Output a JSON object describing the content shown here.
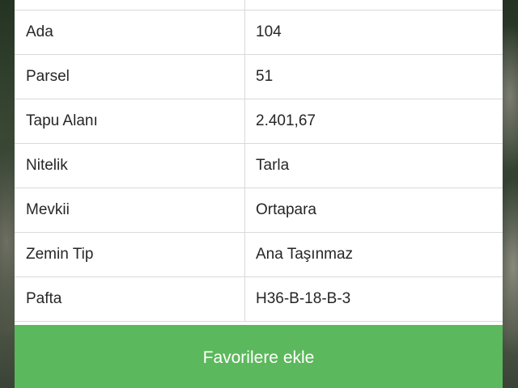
{
  "parcel_info": {
    "rows": [
      {
        "label": "",
        "value": ""
      },
      {
        "label": "Ada",
        "value": "104"
      },
      {
        "label": "Parsel",
        "value": "51"
      },
      {
        "label": "Tapu Alanı",
        "value": "2.401,67"
      },
      {
        "label": "Nitelik",
        "value": "Tarla"
      },
      {
        "label": "Mevkii",
        "value": "Ortapara"
      },
      {
        "label": "Zemin Tip",
        "value": "Ana Taşınmaz"
      },
      {
        "label": "Pafta",
        "value": "H36-B-18-B-3"
      }
    ]
  },
  "actions": {
    "favorite_label": "Favorilere ekle"
  },
  "colors": {
    "button_green": "#5cb85c",
    "panel_background": "#ffffff",
    "divider": "#d9d9d9",
    "text": "#262626"
  }
}
